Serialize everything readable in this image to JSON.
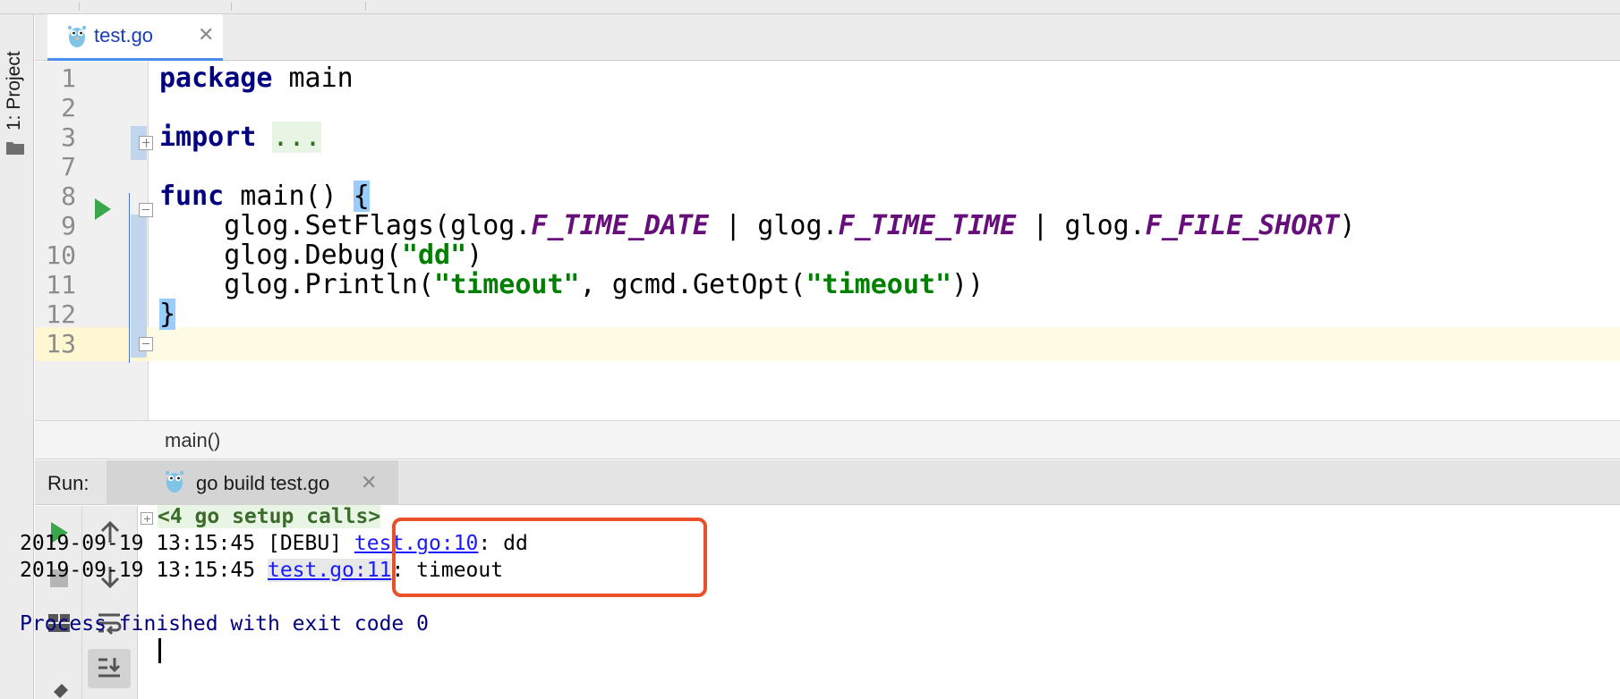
{
  "left_strip": {
    "project_label": "1: Project"
  },
  "editor": {
    "tab": {
      "title": "test.go",
      "close": "✕"
    },
    "lines": [
      {
        "num": "1",
        "segments": [
          {
            "text": "package",
            "cls": "kw"
          },
          {
            "text": " main",
            "cls": ""
          }
        ]
      },
      {
        "num": "2",
        "segments": []
      },
      {
        "num": "3",
        "segments": [
          {
            "text": "import",
            "cls": "kw"
          },
          {
            "text": " ",
            "cls": ""
          },
          {
            "text": "...",
            "cls": "fold-dots"
          }
        ]
      },
      {
        "num": "7",
        "segments": []
      },
      {
        "num": "8",
        "segments": [
          {
            "text": "func",
            "cls": "kw"
          },
          {
            "text": " main() ",
            "cls": ""
          },
          {
            "text": "{",
            "cls": "brace-hl"
          }
        ]
      },
      {
        "num": "9",
        "segments": [
          {
            "text": "    glog.SetFlags(glog.",
            "cls": ""
          },
          {
            "text": "F_TIME_DATE",
            "cls": "const"
          },
          {
            "text": " | glog.",
            "cls": ""
          },
          {
            "text": "F_TIME_TIME",
            "cls": "const"
          },
          {
            "text": " | glog.",
            "cls": ""
          },
          {
            "text": "F_FILE_SHORT",
            "cls": "const"
          },
          {
            "text": ")",
            "cls": ""
          }
        ]
      },
      {
        "num": "10",
        "segments": [
          {
            "text": "    glog.Debug(",
            "cls": ""
          },
          {
            "text": "\"dd\"",
            "cls": "str"
          },
          {
            "text": ")",
            "cls": ""
          }
        ]
      },
      {
        "num": "11",
        "segments": [
          {
            "text": "    glog.Println(",
            "cls": ""
          },
          {
            "text": "\"timeout\"",
            "cls": "str"
          },
          {
            "text": ", gcmd.GetOpt(",
            "cls": ""
          },
          {
            "text": "\"timeout\"",
            "cls": "str"
          },
          {
            "text": "))",
            "cls": ""
          }
        ]
      },
      {
        "num": "12",
        "segments": [
          {
            "text": "}",
            "cls": "brace-hl"
          }
        ]
      },
      {
        "num": "13",
        "segments": []
      }
    ],
    "current_line": "12",
    "breadcrumb": "main()"
  },
  "run": {
    "label": "Run:",
    "tab_title": "go build test.go",
    "tab_close": "✕",
    "console": {
      "setup_calls": "<4 go setup calls>",
      "line1_time": "2019-09-19 13:15:45",
      "line1_level": "[DEBU]",
      "line1_link": "test.go:10",
      "line1_msg": ": dd",
      "line2_time": "2019-09-19 13:15:45",
      "line2_link": "test.go:11",
      "line2_msg": ": timeout",
      "exit": "Process finished with exit code 0"
    },
    "toolbar": [
      "run-icon",
      "stop-icon",
      "layout-icon",
      "pin-icon",
      "up-arrow-icon",
      "down-arrow-icon",
      "soft-wrap-icon",
      "scroll-to-end-icon"
    ]
  },
  "colors": {
    "keyword": "#000080",
    "string": "#008000",
    "constant": "#660e7a",
    "link": "#1a1aff",
    "highlight_box": "#e8512a",
    "current_line": "#fffae3"
  }
}
